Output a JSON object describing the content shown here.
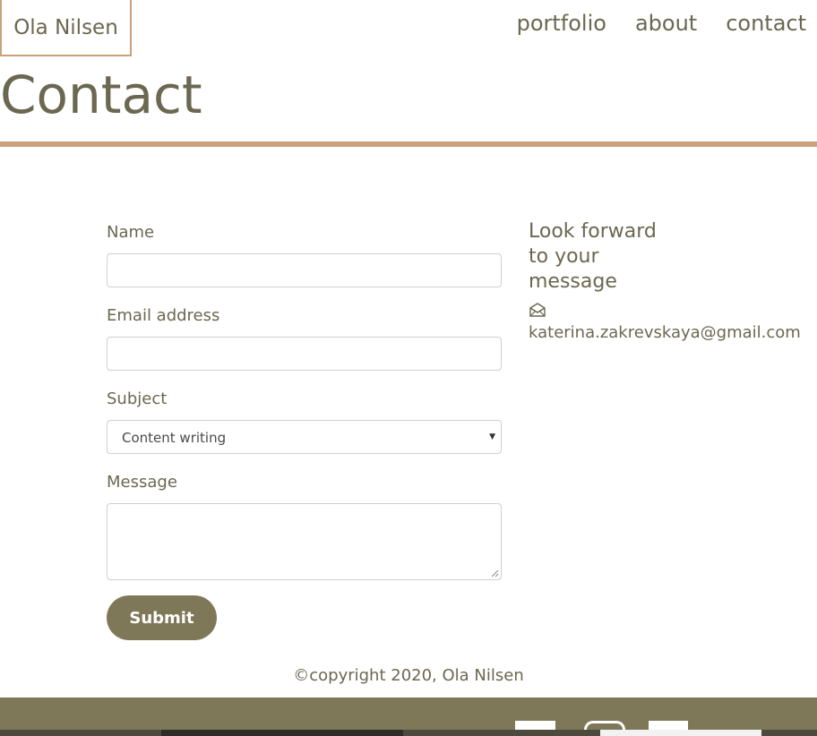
{
  "header": {
    "brand": "Ola Nilsen",
    "nav": [
      "portfolio",
      "about",
      "contact"
    ]
  },
  "page": {
    "title": "Contact"
  },
  "form": {
    "name_label": "Name",
    "name_value": "",
    "email_label": "Email address",
    "email_value": "",
    "subject_label": "Subject",
    "subject_value": "Content writing",
    "message_label": "Message",
    "message_value": "",
    "submit_label": "Submit"
  },
  "aside": {
    "heading": "Look forward to your message",
    "email": "katerina.zakrevskaya@gmail.com",
    "icon": "envelope-open-icon"
  },
  "footer": {
    "copyright": "©copyright 2020, Ola Nilsen"
  },
  "colors": {
    "text": "#6b6750",
    "accent": "#cfa07c",
    "button": "#7f7858"
  }
}
